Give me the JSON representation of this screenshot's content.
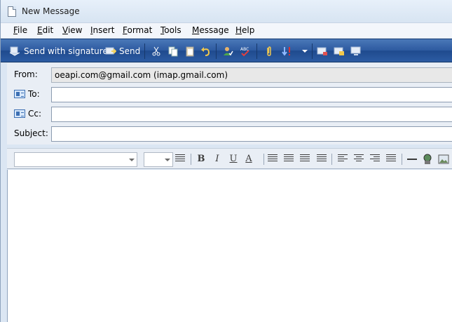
{
  "window": {
    "title": "New Message"
  },
  "menu": [
    {
      "label": "File",
      "u": "F",
      "rest": "ile"
    },
    {
      "label": "Edit",
      "u": "E",
      "rest": "dit"
    },
    {
      "label": "View",
      "u": "V",
      "rest": "iew"
    },
    {
      "label": "Insert",
      "u": "I",
      "rest": "nsert"
    },
    {
      "label": "Format",
      "u": "F",
      "rest": "ormat"
    },
    {
      "label": "Tools",
      "u": "T",
      "rest": "ools"
    },
    {
      "label": "Message",
      "u": "M",
      "rest": "essage"
    },
    {
      "label": "Help",
      "u": "H",
      "rest": "elp"
    }
  ],
  "toolbar": {
    "send_with_signature": "Send with signature",
    "send": "Send"
  },
  "fields": {
    "from_label": "From:",
    "from_value": "oeapi.com@gmail.com    (imap.gmail.com)",
    "to_label": "To:",
    "cc_label": "Cc:",
    "subject_label": "Subject:"
  },
  "format": {
    "bold": "B",
    "italic": "I",
    "underline": "U",
    "font_color": "A"
  },
  "colors": {
    "toolbar": "#2d5aa0",
    "window": "#dbe6f3"
  }
}
